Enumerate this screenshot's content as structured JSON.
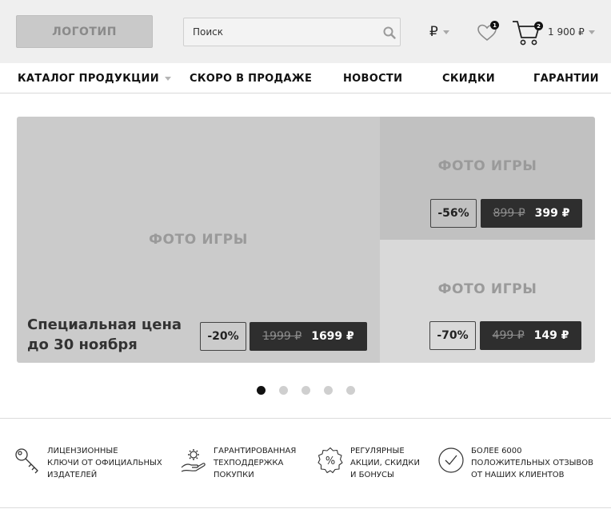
{
  "header": {
    "logo": "ЛОГОТИП",
    "search_placeholder": "Поиск",
    "currency": "₽",
    "favorites_count": "1",
    "cart_count": "2",
    "cart_total": "1 900 ₽"
  },
  "nav": {
    "catalog": "КАТАЛОГ ПРОДУКЦИИ",
    "soon": "СКОРО В ПРОДАЖЕ",
    "news": "НОВОСТИ",
    "discounts": "СКИДКИ",
    "guarantees": "ГАРАНТИИ"
  },
  "banner": {
    "main": {
      "photo": "ФОТО ИГРЫ",
      "title_line1": "Специальная цена",
      "title_line2": "до 30 ноября",
      "discount": "-20%",
      "old_price": "1999 ₽",
      "new_price": "1699 ₽"
    },
    "top_right": {
      "photo": "ФОТО ИГРЫ",
      "discount": "-56%",
      "old_price": "899 ₽",
      "new_price": "399 ₽"
    },
    "bottom_right": {
      "photo": "ФОТО ИГРЫ",
      "discount": "-70%",
      "old_price": "499 ₽",
      "new_price": "149 ₽"
    }
  },
  "carousel": {
    "total_slides": 5,
    "active_slide": 1
  },
  "features": [
    {
      "icon": "key-icon",
      "text": "ЛИЦЕНЗИОННЫЕ\nКЛЮЧИ ОТ ОФИЦИАЛЬНЫХ\nИЗДАТЕЛЕЙ"
    },
    {
      "icon": "support-hand-gear-icon",
      "text": "ГАРАНТИРОВАННАЯ\nТЕХПОДДЕРЖКА\nПОКУПКИ"
    },
    {
      "icon": "percent-badge-icon",
      "text": "РЕГУЛЯРНЫЕ\nАКЦИИ, СКИДКИ\nИ БОНУСЫ"
    },
    {
      "icon": "check-circle-icon",
      "text": "БОЛЕЕ 6000\nПОЛОЖИТЕЛЬНЫХ ОТЗЫВОВ\nОТ НАШИХ КЛИЕНТОВ"
    }
  ]
}
